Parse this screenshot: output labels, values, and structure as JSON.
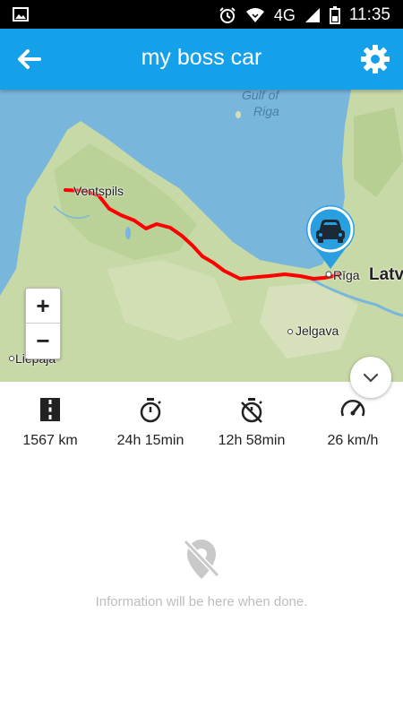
{
  "status_bar": {
    "network": "4G",
    "time": "11:35",
    "icons": [
      "image-icon",
      "alarm-icon",
      "wifi-icon",
      "signal-icon",
      "battery-icon"
    ]
  },
  "app_bar": {
    "title": "my boss car",
    "back_icon": "arrow-left-icon",
    "settings_icon": "gear-icon",
    "color": "#15a0ea"
  },
  "map": {
    "labels": {
      "gulf_line1": "Gulf of",
      "gulf_line2": "Riga",
      "ventspils": "Ventspils",
      "riga": "Rīga",
      "latvia": "Latv",
      "jelgava": "Jelgava",
      "liepaja": "Liepāja"
    },
    "zoom_in": "+",
    "zoom_out": "−",
    "route_color": "#ff0000",
    "marker_icon": "car-icon",
    "collapse_icon": "chevron-down-icon"
  },
  "stats": [
    {
      "icon": "road-icon",
      "value": "1567 km"
    },
    {
      "icon": "stopwatch-icon",
      "value": "24h 15min"
    },
    {
      "icon": "stopwatch-off-icon",
      "value": "12h 58min"
    },
    {
      "icon": "speedometer-icon",
      "value": "26 km/h"
    }
  ],
  "empty_state": {
    "icon": "location-off-icon",
    "message": "Information will be here when done."
  }
}
